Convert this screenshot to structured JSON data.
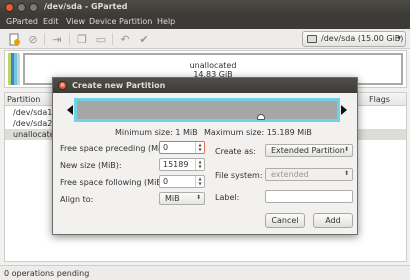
{
  "window": {
    "title": "/dev/sda - GParted"
  },
  "menubar": [
    "GParted",
    "Edit",
    "View",
    "Device",
    "Partition",
    "Help"
  ],
  "toolbar": {
    "icons": [
      "new-partition-icon",
      "delete-icon",
      "resize-icon",
      "copy-icon",
      "paste-icon",
      "undo-icon",
      "apply-icon"
    ],
    "device": "/dev/sda  (15.00 GiB)"
  },
  "disk_graph": {
    "name": "unallocated",
    "size": "14.83 GiB"
  },
  "partition_table": {
    "headers": [
      "Partition",
      "Flags"
    ],
    "rows": [
      "/dev/sda1",
      "/dev/sda2",
      "unallocated"
    ]
  },
  "dialog": {
    "title": "Create new Partition",
    "min_size": "Minimum size: 1 MiB",
    "max_size": "Maximum size: 15.189 MiB",
    "fields": {
      "free_before_label": "Free space preceding (MiB):",
      "free_before_value": "0",
      "new_size_label": "New size (MiB):",
      "new_size_value": "15189",
      "free_after_label": "Free space following (MiB):",
      "free_after_value": "0",
      "align_label": "Align to:",
      "align_value": "MiB",
      "create_as_label": "Create as:",
      "create_as_value": "Extended Partition",
      "filesystem_label": "File system:",
      "filesystem_value": "extended",
      "label_label": "Label:",
      "label_value": ""
    },
    "buttons": {
      "cancel": "Cancel",
      "add": "Add"
    }
  },
  "status": "0 operations pending"
}
